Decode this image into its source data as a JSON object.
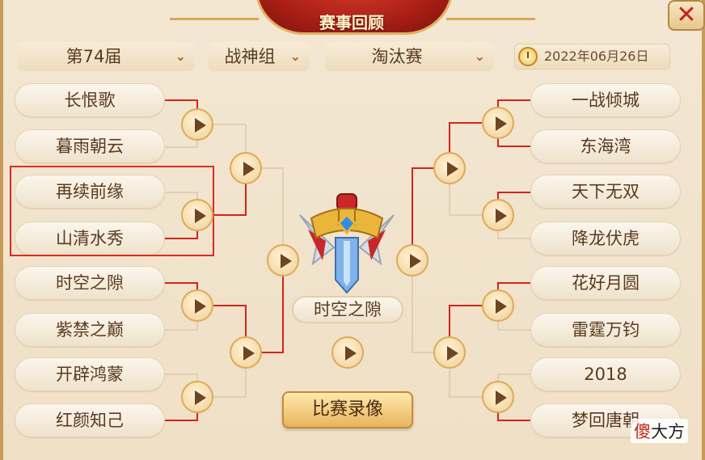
{
  "header": {
    "title": "赛事回顾",
    "close_label": "✕"
  },
  "filters": {
    "season": "第74届",
    "group": "战神组",
    "stage": "淘汰赛",
    "date": "2022年06月26日"
  },
  "bracket": {
    "left_teams": [
      "长恨歌",
      "暮雨朝云",
      "再续前缘",
      "山清水秀",
      "时空之隙",
      "紫禁之巅",
      "开辟鸿蒙",
      "红颜知己"
    ],
    "right_teams": [
      "一战倾城",
      "东海湾",
      "天下无双",
      "降龙伏虎",
      "花好月圆",
      "雷霆万钧",
      "2018",
      "梦回唐朝"
    ],
    "champion": "时空之隙"
  },
  "actions": {
    "record_button": "比赛录像"
  },
  "watermark": {
    "part1": "傻",
    "part2": "大方"
  },
  "colors": {
    "line_red": "#d4241b",
    "line_tan": "#e0cfb2",
    "highlight": "#e12a1f"
  }
}
